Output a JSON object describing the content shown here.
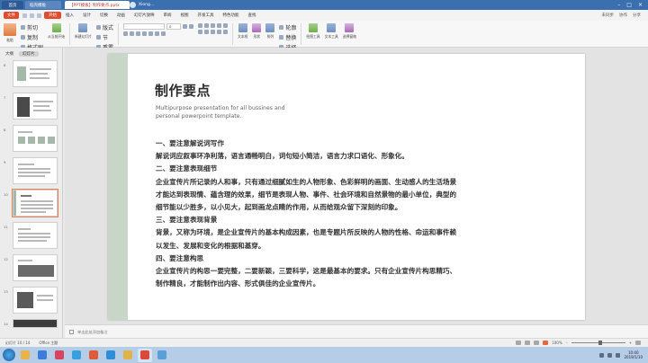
{
  "titlebar": {
    "home_tab": "首页",
    "tab_app": "稻壳模板",
    "tab_doc": "【PPT模板】制作要点.pptx",
    "user_name": "Xiong...",
    "minimize_icon": "minimize-icon",
    "maximize_icon": "maximize-icon",
    "close_icon": "close-icon"
  },
  "menubar": {
    "file_label": "文件",
    "items": [
      "开始",
      "插入",
      "设计",
      "切换",
      "动画",
      "幻灯片放映",
      "审阅",
      "视图",
      "开发工具",
      "特色功能",
      "查找"
    ],
    "active_index": 0,
    "right_items": [
      "未同步",
      "协作",
      "分享"
    ]
  },
  "ribbon": {
    "paste_label": "粘贴",
    "cut_label": "剪切",
    "copy_label": "复制",
    "format_painter_label": "格式刷",
    "from_current_label": "从当前开始",
    "new_slide_label": "新建幻灯片",
    "layout_label": "版式",
    "section_label": "节",
    "reset_label": "重置",
    "font_name": "",
    "font_size": "0",
    "textbox_label": "文本框",
    "shape_label": "形状",
    "arrange_label": "排列",
    "outline_label": "轮廓",
    "replace_label": "替换",
    "select_label": "选择",
    "drawing_tools_label": "绘图工具",
    "text_tools_label": "文本工具",
    "select_pane_label": "选择窗格"
  },
  "leftpanel": {
    "tab_outline": "大纲",
    "tab_slides": "幻灯片",
    "slide_numbers": [
      "6",
      "7",
      "8",
      "9",
      "10",
      "11",
      "12",
      "13",
      "14"
    ],
    "selected_index": 4,
    "add_label": "+"
  },
  "slide": {
    "title": "制作要点",
    "subtitle": "Multipurpose presentation for all bussines and personal powerpoint template.",
    "lines": [
      "一、要注意解说词写作",
      "解说词应叙事环净利落，语言通畅明白，词句短小简洁，语言力求口语化、形象化。",
      "二、要注意表现细节",
      "企业宣传片所记录的人和事，只有通过细腻如生的人物形象、色彩鲜明的画面、生动感人的生活场景",
      "才能达到表现情、蕴含理的效果，细节是表现人物、事件、社会环境和自然景物的最小单位，典型的",
      "细节能以少胜多，以小见大，起到画龙点睛的作用，从而给观众留下深刻的印象。",
      "三、要注意表现背景",
      "背景，又称为环境，是企业宣传片的基本构成因素，也是专题片所反映的人物的性格、命运和事件赖",
      "以发生、发展和变化的根据和基穿。",
      "四、要注意构思",
      "企业宣传片的构思一要完整，二要新颖，三要科学，这是最基本的要求。只有企业宣传片构思精巧、",
      "制作精良，才能制作出内容、形式俱佳的企业宣传片。"
    ]
  },
  "notes": {
    "placeholder": "单击此处添加备注"
  },
  "statusbar": {
    "slide_info": "幻灯片 10 / 14",
    "theme": "Office 主题",
    "zoom": "100%"
  },
  "taskbar": {
    "apps": [
      {
        "icon": "explorer-icon",
        "color": "#e8b449"
      },
      {
        "icon": "browser-icon",
        "color": "#3b7dd8"
      },
      {
        "icon": "media-icon",
        "color": "#d6475d"
      },
      {
        "icon": "mail-icon",
        "color": "#3aa0dc"
      },
      {
        "icon": "music-icon",
        "color": "#e05a3a"
      },
      {
        "icon": "ie-icon",
        "color": "#2f8dd6"
      },
      {
        "icon": "folder-icon",
        "color": "#e2b24a"
      },
      {
        "icon": "wps-icon",
        "color": "#d94a3a"
      },
      {
        "icon": "photos-icon",
        "color": "#5aa0d8"
      }
    ],
    "active_index": 7,
    "time": "10:40",
    "date": "2019/1/10"
  },
  "colors": {
    "accent": "#e24b2b",
    "titlebar": "#3a6fb0",
    "slide_bar": "#c8d6c8"
  }
}
